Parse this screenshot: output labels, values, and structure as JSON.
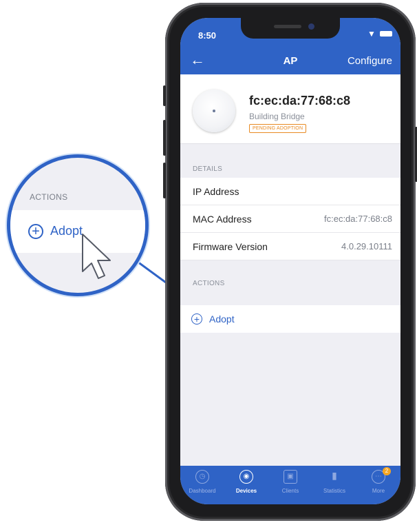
{
  "status_bar": {
    "time": "8:50"
  },
  "nav": {
    "back_icon": "back-arrow-icon",
    "title": "AP",
    "configure": "Configure"
  },
  "device": {
    "name": "fc:ec:da:77:68:c8",
    "model": "Building Bridge",
    "status_badge": "PENDING ADOPTION"
  },
  "details": {
    "section_label": "DETAILS",
    "rows": [
      {
        "label": "IP Address",
        "value": ""
      },
      {
        "label": "MAC Address",
        "value": "fc:ec:da:77:68:c8"
      },
      {
        "label": "Firmware Version",
        "value": "4.0.29.10111"
      }
    ]
  },
  "actions": {
    "section_label": "ACTIONS",
    "adopt_label": "Adopt",
    "adopt_icon": "plus-circle-icon"
  },
  "tabbar": {
    "tabs": [
      {
        "label": "Dashboard",
        "icon": "dashboard-icon",
        "active": false
      },
      {
        "label": "Devices",
        "icon": "devices-icon",
        "active": true
      },
      {
        "label": "Clients",
        "icon": "clients-icon",
        "active": false
      },
      {
        "label": "Statistics",
        "icon": "statistics-icon",
        "active": false
      },
      {
        "label": "More",
        "icon": "more-icon",
        "active": false,
        "badge": "2"
      }
    ]
  },
  "callout": {
    "section_label": "ACTIONS",
    "adopt_label": "Adopt"
  },
  "colors": {
    "accent": "#2f63c6",
    "badge_orange": "#e88a22",
    "background": "#efeff4"
  }
}
